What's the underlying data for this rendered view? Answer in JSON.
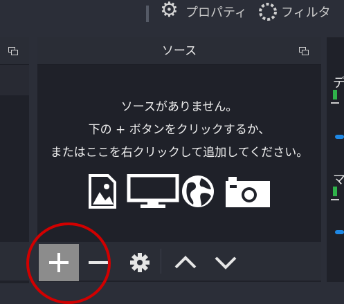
{
  "toolbar": {
    "properties_label": "プロパティ",
    "filters_label": "フィルタ"
  },
  "sources_panel": {
    "title": "ソース",
    "empty_line1": "ソースがありません。",
    "empty_line2": "下の + ボタンをクリックするか、",
    "empty_line3": "またはここを右クリックして追加してください。",
    "source_type_icons": [
      "image-icon",
      "display-capture-icon",
      "browser-globe-icon",
      "camera-icon"
    ]
  },
  "footer_toolbar": {
    "buttons": [
      "add-icon",
      "remove-icon",
      "gear-icon",
      "move-up-icon",
      "move-down-icon"
    ]
  },
  "right_panel": {
    "label_1": "デ",
    "label_2": "マ"
  },
  "colors": {
    "background": "#2b2e38",
    "panel": "#1f2129",
    "panel_header": "#2a2d36",
    "add_button_active": "#8c8c8c",
    "annotation_red": "#d10000",
    "meter_green": "#2fb24a",
    "volume_blue": "#1e88e5"
  }
}
